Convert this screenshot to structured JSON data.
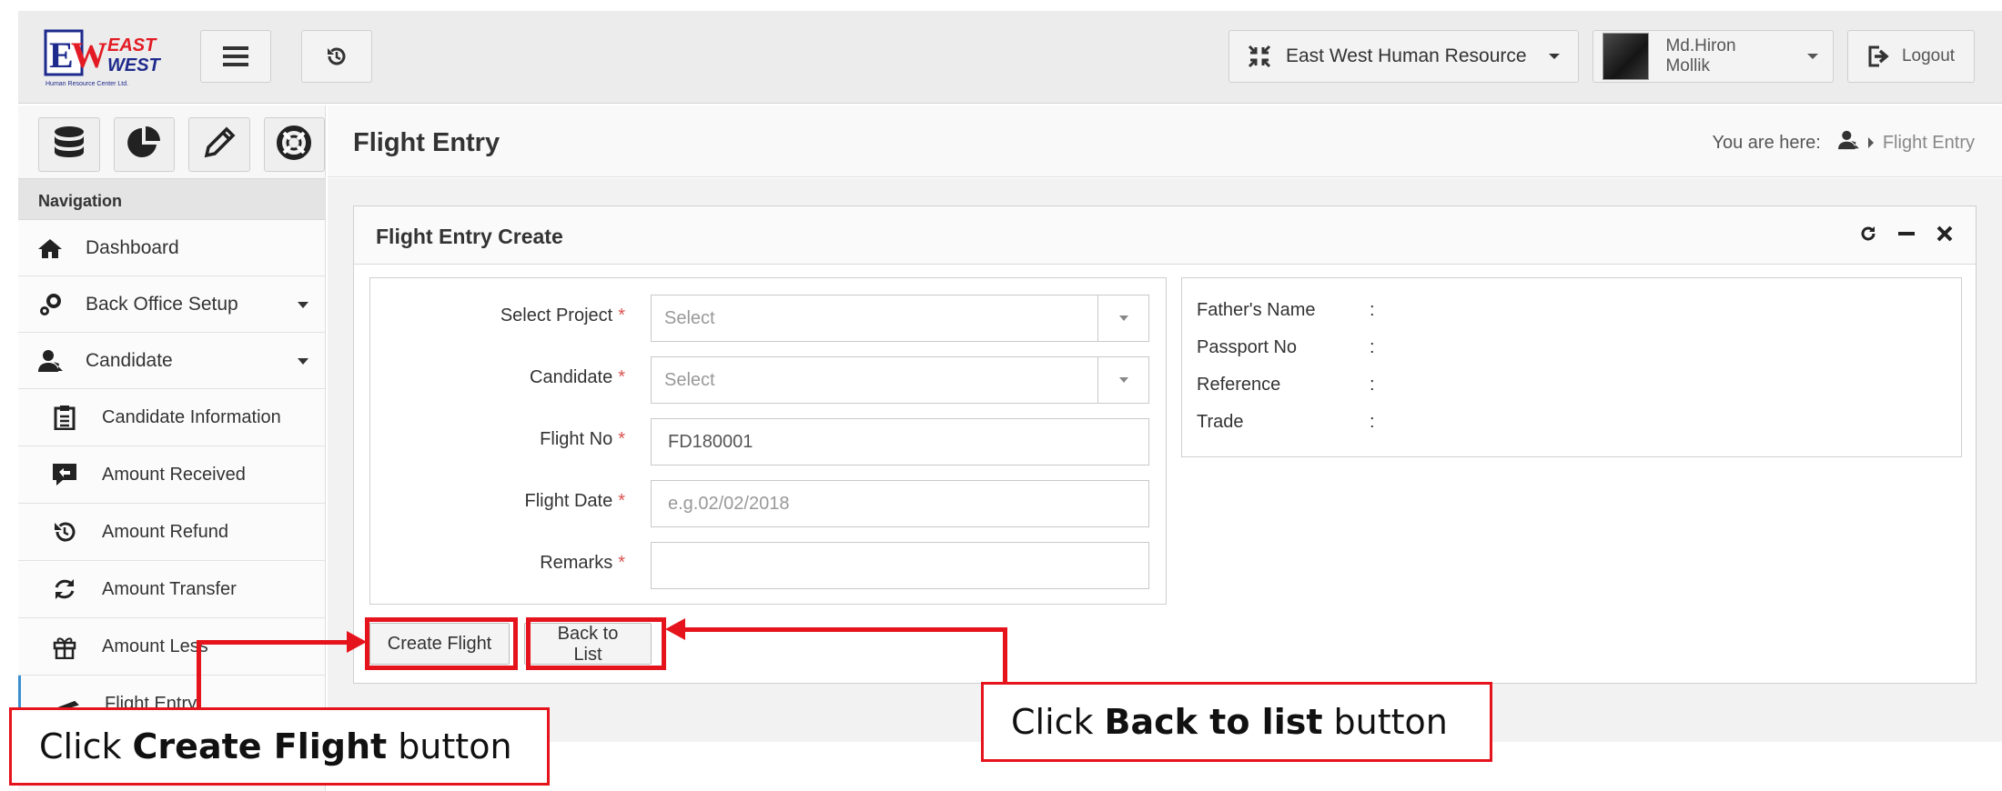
{
  "header": {
    "logo_alt": "East West Human Resource Center Ltd.",
    "logo_text_top": "EAST",
    "logo_text_bottom": "WEST",
    "logo_sub": "Human Resource Center Ltd.",
    "organization": "East West Human Resource",
    "user_name": "Md.Hiron Mollik",
    "logout_label": "Logout"
  },
  "sidebar": {
    "nav_heading": "Navigation",
    "items": [
      {
        "label": "Dashboard",
        "icon": "home-icon"
      },
      {
        "label": "Back Office Setup",
        "icon": "cogs-icon",
        "expandable": true
      },
      {
        "label": "Candidate",
        "icon": "user-tie-icon",
        "expandable": true
      }
    ],
    "sub_items": [
      {
        "label": "Candidate Information",
        "icon": "clipboard-icon"
      },
      {
        "label": "Amount Received",
        "icon": "reply-comment-icon"
      },
      {
        "label": "Amount Refund",
        "icon": "history-icon"
      },
      {
        "label": "Amount Transfer",
        "icon": "refresh-icon"
      },
      {
        "label": "Amount Less",
        "icon": "gift-icon"
      },
      {
        "label": "Flight Entry",
        "icon": "plane-icon"
      }
    ]
  },
  "page": {
    "title": "Flight Entry",
    "breadcrumb_prefix": "You are here:",
    "breadcrumb_current": "Flight Entry"
  },
  "panel": {
    "title": "Flight Entry Create",
    "form": {
      "select_project_label": "Select Project",
      "select_project_value": "Select",
      "candidate_label": "Candidate",
      "candidate_value": "Select",
      "flight_no_label": "Flight No",
      "flight_no_value": "FD180001",
      "flight_date_label": "Flight Date",
      "flight_date_placeholder": "e.g.02/02/2018",
      "remarks_label": "Remarks",
      "remarks_value": "",
      "required_mark": "*"
    },
    "info": {
      "fathers_name_label": "Father's Name",
      "passport_no_label": "Passport No",
      "reference_label": "Reference",
      "trade_label": "Trade",
      "separator": ":"
    },
    "buttons": {
      "create_label": "Create Flight",
      "back_label": "Back to List"
    }
  },
  "annotations": {
    "create_click": "Click",
    "create_bold": "Create Flight",
    "create_suffix": "button",
    "back_click": "Click",
    "back_bold": "Back to list",
    "back_suffix": "button"
  },
  "colors": {
    "annotation_red": "#e5141c",
    "required_red": "#d9534f",
    "logo_red": "#e21b24",
    "logo_blue": "#1e2a8c"
  }
}
